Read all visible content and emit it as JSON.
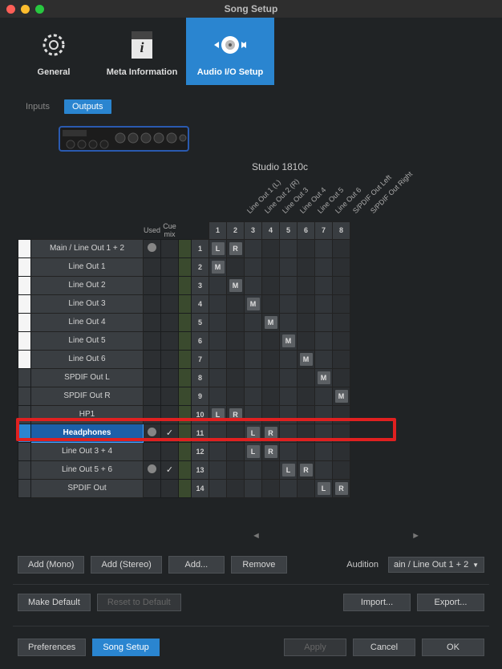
{
  "window": {
    "title": "Song Setup"
  },
  "top_tabs": [
    {
      "label": "General"
    },
    {
      "label": "Meta Information"
    },
    {
      "label": "Audio I/O Setup",
      "selected": true
    }
  ],
  "io_tabs": {
    "inputs": "Inputs",
    "outputs": "Outputs",
    "selected": "Outputs"
  },
  "device": {
    "name": "Studio 1810c"
  },
  "col_headers": {
    "used": "Used",
    "cue": "Cue mix"
  },
  "diag_labels": [
    "Line Out 1 (L)",
    "Line Out 2 (R)",
    "Line Out 3",
    "Line Out 4",
    "Line Out 5",
    "Line Out 6",
    "S/PDIF Out Left",
    "S/PDIF Out Right"
  ],
  "ch_numbers": [
    "1",
    "2",
    "3",
    "4",
    "5",
    "6",
    "7",
    "8"
  ],
  "rows": [
    {
      "idx": "1",
      "name": "Main / Line Out 1 + 2",
      "color": "white",
      "used": true,
      "cue": false,
      "cells": {
        "1": "L",
        "2": "R"
      }
    },
    {
      "idx": "2",
      "name": "Line Out 1",
      "color": "white",
      "used": false,
      "cue": false,
      "cells": {
        "1": "M"
      }
    },
    {
      "idx": "3",
      "name": "Line Out 2",
      "color": "white",
      "used": false,
      "cue": false,
      "cells": {
        "2": "M"
      }
    },
    {
      "idx": "4",
      "name": "Line Out 3",
      "color": "white",
      "used": false,
      "cue": false,
      "cells": {
        "3": "M"
      }
    },
    {
      "idx": "5",
      "name": "Line Out 4",
      "color": "white",
      "used": false,
      "cue": false,
      "cells": {
        "4": "M"
      }
    },
    {
      "idx": "6",
      "name": "Line Out 5",
      "color": "white",
      "used": false,
      "cue": false,
      "cells": {
        "5": "M"
      }
    },
    {
      "idx": "7",
      "name": "Line Out 6",
      "color": "white",
      "used": false,
      "cue": false,
      "cells": {
        "6": "M"
      }
    },
    {
      "idx": "8",
      "name": "SPDIF Out L",
      "color": "none",
      "used": false,
      "cue": false,
      "cells": {
        "7": "M"
      }
    },
    {
      "idx": "9",
      "name": "SPDIF Out R",
      "color": "none",
      "used": false,
      "cue": false,
      "cells": {
        "8": "M"
      }
    },
    {
      "idx": "10",
      "name": "HP1",
      "color": "none",
      "used": false,
      "cue": false,
      "cells": {
        "1": "L",
        "2": "R"
      }
    },
    {
      "idx": "11",
      "name": "Headphones",
      "color": "blue",
      "used": true,
      "cue": true,
      "cells": {
        "3": "L",
        "4": "R"
      },
      "selected": true,
      "highlight": true
    },
    {
      "idx": "12",
      "name": "Line Out 3 + 4",
      "color": "none",
      "used": false,
      "cue": false,
      "cells": {
        "3": "L",
        "4": "R"
      }
    },
    {
      "idx": "13",
      "name": "Line Out 5 + 6",
      "color": "none",
      "used": true,
      "cue": true,
      "cells": {
        "5": "L",
        "6": "R"
      }
    },
    {
      "idx": "14",
      "name": "SPDIF Out",
      "color": "none",
      "used": false,
      "cue": false,
      "cells": {
        "7": "L",
        "8": "R"
      }
    }
  ],
  "buttons": {
    "add_mono": "Add (Mono)",
    "add_stereo": "Add (Stereo)",
    "add": "Add...",
    "remove": "Remove",
    "audition_label": "Audition",
    "audition_value": "ain / Line Out 1 + 2",
    "make_default": "Make Default",
    "reset": "Reset to Default",
    "import": "Import...",
    "export": "Export...",
    "preferences": "Preferences",
    "song_setup": "Song Setup",
    "apply": "Apply",
    "cancel": "Cancel",
    "ok": "OK"
  }
}
